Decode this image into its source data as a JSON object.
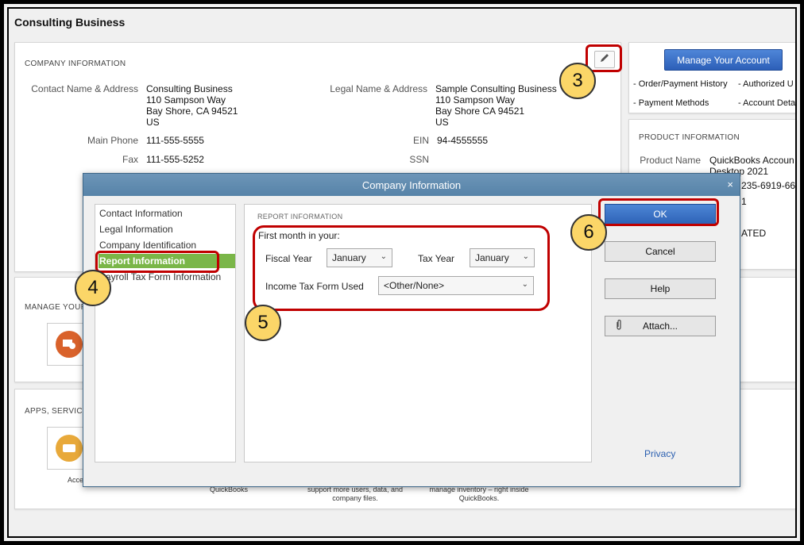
{
  "page": {
    "title": "Consulting Business"
  },
  "company_info": {
    "heading": "COMPANY INFORMATION",
    "contact_label": "Contact Name & Address",
    "contact_lines": [
      "Consulting Business",
      "110 Sampson Way",
      "Bay Shore, CA  94521",
      "US"
    ],
    "legal_label": "Legal Name & Address",
    "legal_lines": [
      "Sample Consulting Business",
      "110 Sampson Way",
      "Bay Shore CA 94521",
      "US"
    ],
    "main_phone_label": "Main Phone",
    "main_phone": "111-555-5555",
    "fax_label": "Fax",
    "fax": "111-555-5252",
    "ein_label": "EIN",
    "ein": "94-4555555",
    "ssn_label": "SSN"
  },
  "account": {
    "manage_button": "Manage Your Account",
    "links": [
      "- Order/Payment History",
      "- Authorized U",
      "- Payment Methods",
      "- Account Deta"
    ]
  },
  "product_info": {
    "heading": "PRODUCT INFORMATION",
    "product_name_label": "Product Name",
    "product_name_lines": [
      "QuickBooks Accoun",
      "Desktop 2021"
    ],
    "license_fragment": "235-6919-66",
    "fragment2": "1",
    "status_fragment": "ATED"
  },
  "manage_section": {
    "heading": "MANAGE YOUR"
  },
  "apps_section": {
    "heading": "APPS, SERVICE",
    "tile_label": "Acce",
    "desc1": "QuickBooks",
    "desc2": [
      "support more users, data, and",
      "company files."
    ],
    "desc3": [
      "manage inventory – right inside",
      "QuickBooks."
    ]
  },
  "dialog": {
    "title": "Company Information",
    "close": "×",
    "nav": [
      "Contact Information",
      "Legal Information",
      "Company Identification",
      "Report Information",
      "Payroll Tax Form Information"
    ],
    "nav_selected": "Report Information",
    "section_heading": "REPORT INFORMATION",
    "first_month_label": "First month in your:",
    "fiscal_year_label": "Fiscal Year",
    "fiscal_year_value": "January",
    "tax_year_label": "Tax Year",
    "tax_year_value": "January",
    "income_tax_label": "Income Tax Form Used",
    "income_tax_value": "<Other/None>",
    "buttons": {
      "ok": "OK",
      "cancel": "Cancel",
      "help": "Help",
      "attach": "Attach..."
    },
    "privacy": "Privacy"
  },
  "callouts": [
    "3",
    "4",
    "5",
    "6"
  ],
  "colors": {
    "highlight_red": "#c00000",
    "badge_yellow": "#fbd668",
    "nav_selected_green": "#7ab648",
    "button_blue": "#2e63b7"
  }
}
